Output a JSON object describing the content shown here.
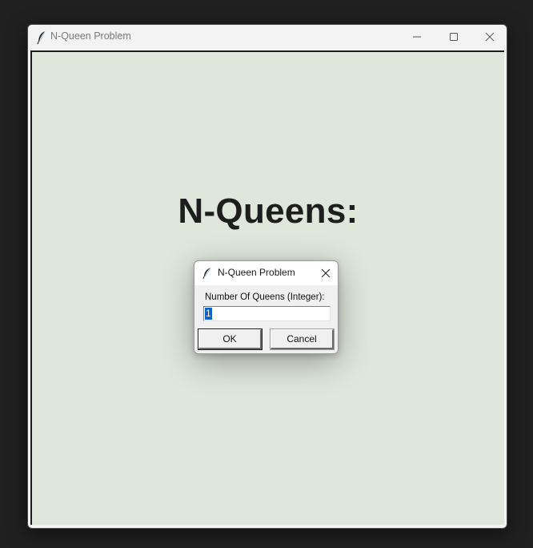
{
  "main_window": {
    "title": "N-Queen Problem",
    "icon": "feather-icon",
    "heading": "N-Queens:"
  },
  "dialog": {
    "title": "N-Queen Problem",
    "icon": "feather-icon",
    "prompt": "Number Of Queens (Integer):",
    "input_value": "1",
    "ok_label": "OK",
    "cancel_label": "Cancel"
  },
  "colors": {
    "canvas_background": "#dfe6dc",
    "selection": "#0a64c8",
    "desktop": "#202020"
  }
}
